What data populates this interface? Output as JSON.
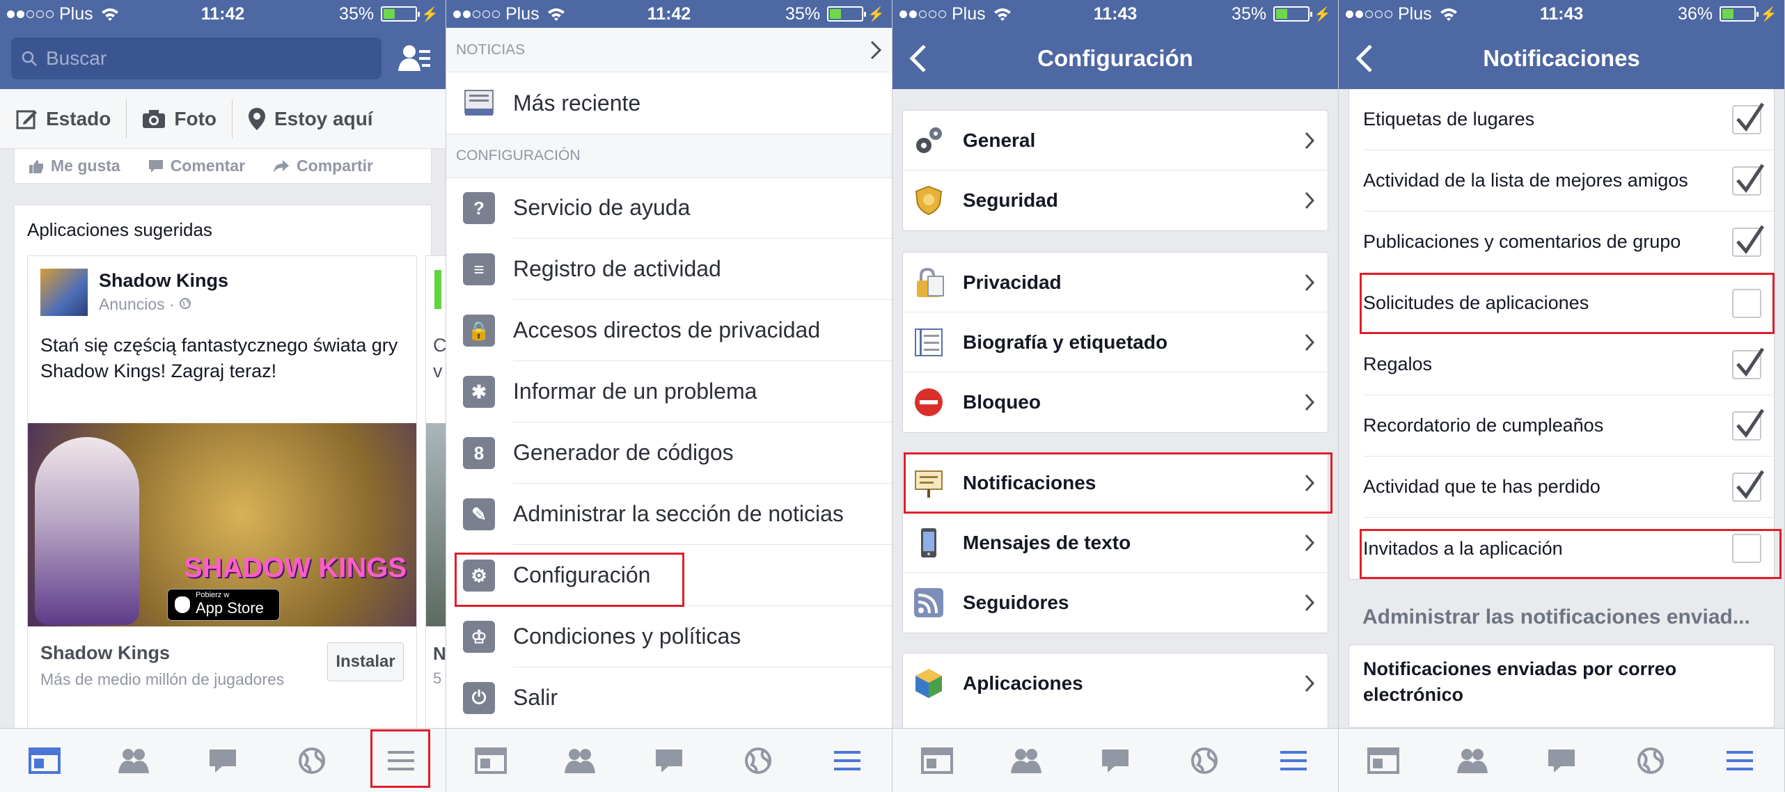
{
  "status_bars": [
    {
      "carrier": "Plus",
      "time": "11:42",
      "battery": "35%"
    },
    {
      "carrier": "Plus",
      "time": "11:42",
      "battery": "35%"
    },
    {
      "carrier": "Plus",
      "time": "11:43",
      "battery": "35%"
    },
    {
      "carrier": "Plus",
      "time": "11:43",
      "battery": "36%"
    }
  ],
  "feed": {
    "search_placeholder": "Buscar",
    "composer": [
      "Estado",
      "Foto",
      "Estoy aquí"
    ],
    "post_actions": [
      "Me gusta",
      "Comentar",
      "Compartir"
    ],
    "suggested_header": "Aplicaciones sugeridas",
    "ad": {
      "name": "Shadow Kings",
      "sponsored": "Anuncios · ",
      "description": "Stań się częścią fantastycznego świata gry Shadow Kings! Zagraj teraz!",
      "image_brand": "SHADOW KINGS",
      "store_small": "Pobierz w",
      "store_big": "App Store",
      "footer_name": "Shadow Kings",
      "footer_sub": "Más de medio millón de jugadores",
      "install": "Instalar"
    },
    "ad2_partial": {
      "text": "C v",
      "footer": "N",
      "sub": "5"
    }
  },
  "menu": {
    "section_noticias": "NOTICIAS",
    "recent": "Más reciente",
    "section_config": "CONFIGURACIÓN",
    "items": [
      {
        "label": "Servicio de ayuda",
        "icon": "help-icon",
        "glyph": "?"
      },
      {
        "label": "Registro de actividad",
        "icon": "activity-log-icon",
        "glyph": "≡"
      },
      {
        "label": "Accesos directos de privacidad",
        "icon": "privacy-lock-icon",
        "glyph": "🔒"
      },
      {
        "label": "Informar de un problema",
        "icon": "bug-icon",
        "glyph": "✱"
      },
      {
        "label": "Generador de códigos",
        "icon": "code-generator-icon",
        "glyph": "8"
      },
      {
        "label": "Administrar la sección de noticias",
        "icon": "news-feed-edit-icon",
        "glyph": "✎"
      },
      {
        "label": "Configuración",
        "icon": "gear-icon",
        "glyph": "⚙"
      },
      {
        "label": "Condiciones y políticas",
        "icon": "policies-icon",
        "glyph": "♔"
      },
      {
        "label": "Salir",
        "icon": "power-icon",
        "glyph": "⏻"
      }
    ]
  },
  "settings": {
    "title": "Configuración",
    "groups": [
      [
        {
          "label": "General",
          "icon": "gears-icon"
        },
        {
          "label": "Seguridad",
          "icon": "shield-badge-icon"
        }
      ],
      [
        {
          "label": "Privacidad",
          "icon": "lock-icon"
        },
        {
          "label": "Biografía y etiquetado",
          "icon": "timeline-icon"
        },
        {
          "label": "Bloqueo",
          "icon": "block-icon"
        }
      ],
      [
        {
          "label": "Notificaciones",
          "icon": "notification-sign-icon"
        },
        {
          "label": "Mensajes de texto",
          "icon": "phone-icon"
        },
        {
          "label": "Seguidores",
          "icon": "rss-icon"
        }
      ],
      [
        {
          "label": "Aplicaciones",
          "icon": "app-cube-icon"
        }
      ]
    ]
  },
  "notifications": {
    "title": "Notificaciones",
    "items": [
      {
        "label": "Etiquetas de lugares",
        "checked": true
      },
      {
        "label": "Actividad de la lista de mejores amigos",
        "checked": true
      },
      {
        "label": "Publicaciones y comentarios de grupo",
        "checked": true
      },
      {
        "label": "Solicitudes de aplicaciones",
        "checked": false
      },
      {
        "label": "Regalos",
        "checked": true
      },
      {
        "label": "Recordatorio de cumpleaños",
        "checked": true
      },
      {
        "label": "Actividad que te has perdido",
        "checked": true
      },
      {
        "label": "Invitados a la aplicación",
        "checked": false
      }
    ],
    "section": "Administrar las notificaciones enviad...",
    "email_row": "Notificaciones enviadas por correo electrónico"
  },
  "colors": {
    "fb_blue": "#4d68a2",
    "highlight_red": "#e01e2a",
    "tab_active": "#4a76d8",
    "tab_inactive": "#9197a3"
  }
}
